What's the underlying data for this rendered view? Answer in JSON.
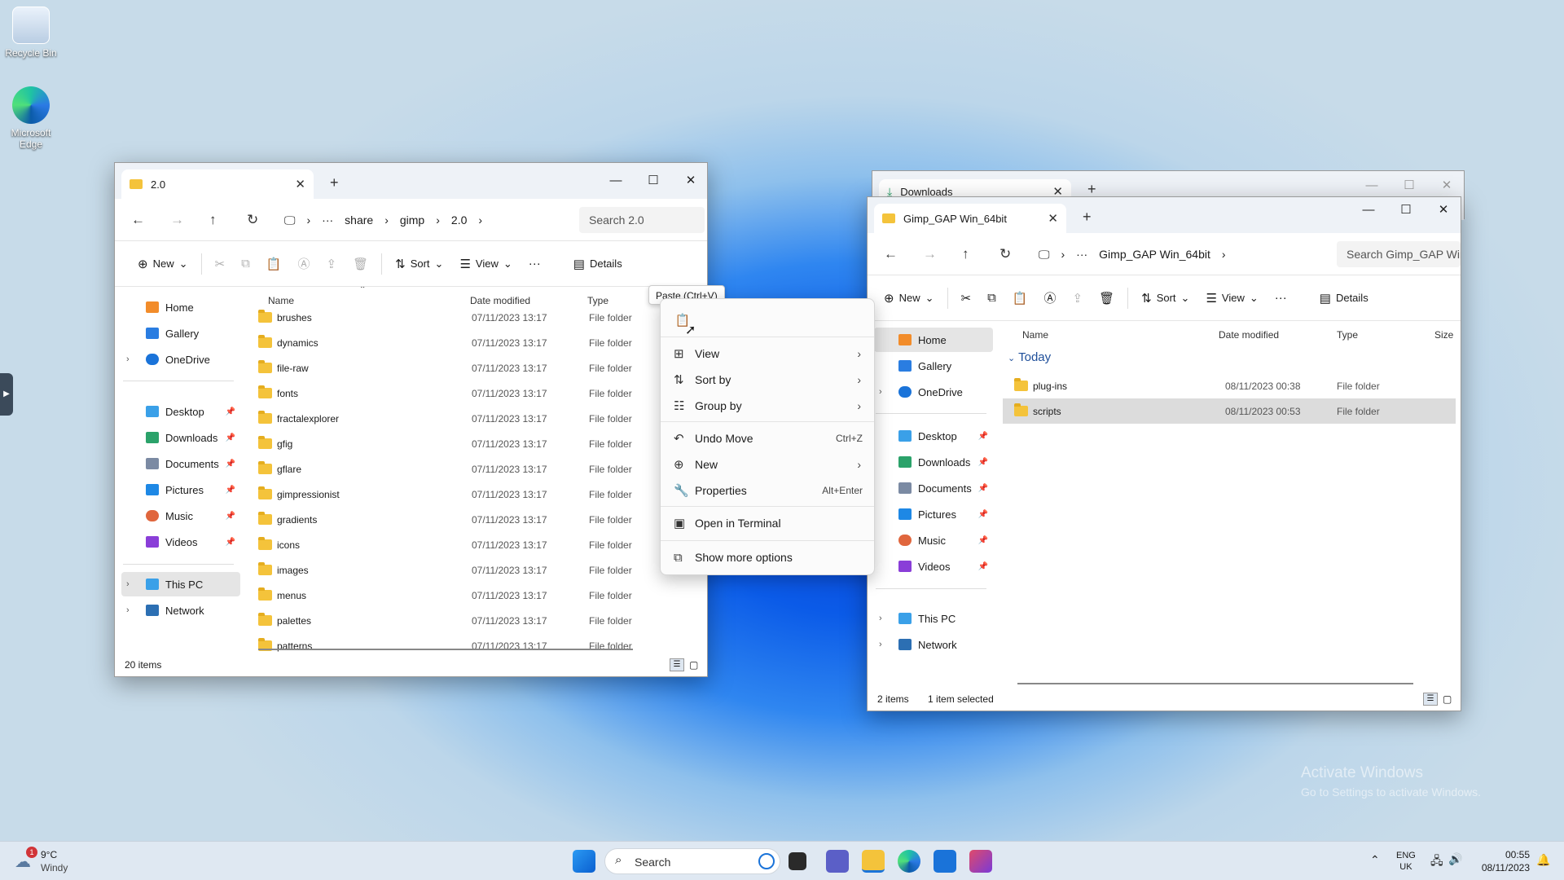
{
  "desktop": {
    "icons": [
      {
        "label": "Recycle Bin"
      },
      {
        "label": "Microsoft Edge"
      }
    ],
    "watermark": {
      "title": "Activate Windows",
      "subtitle": "Go to Settings to activate Windows."
    }
  },
  "win1": {
    "tab_title": "2.0",
    "breadcrumb": [
      "share",
      "gimp",
      "2.0"
    ],
    "search_placeholder": "Search 2.0",
    "commands": {
      "new": "New",
      "sort": "Sort",
      "view": "View",
      "details": "Details"
    },
    "nav": {
      "top": [
        "Home",
        "Gallery",
        "OneDrive"
      ],
      "pinned": [
        "Desktop",
        "Downloads",
        "Documents",
        "Pictures",
        "Music",
        "Videos"
      ],
      "bottom": [
        "This PC",
        "Network"
      ]
    },
    "columns": {
      "name": "Name",
      "date": "Date modified",
      "type": "Type"
    },
    "rows": [
      {
        "name": "brushes",
        "date": "07/11/2023 13:17",
        "type": "File folder"
      },
      {
        "name": "dynamics",
        "date": "07/11/2023 13:17",
        "type": "File folder"
      },
      {
        "name": "file-raw",
        "date": "07/11/2023 13:17",
        "type": "File folder"
      },
      {
        "name": "fonts",
        "date": "07/11/2023 13:17",
        "type": "File folder"
      },
      {
        "name": "fractalexplorer",
        "date": "07/11/2023 13:17",
        "type": "File folder"
      },
      {
        "name": "gfig",
        "date": "07/11/2023 13:17",
        "type": "File folder"
      },
      {
        "name": "gflare",
        "date": "07/11/2023 13:17",
        "type": "File folder"
      },
      {
        "name": "gimpressionist",
        "date": "07/11/2023 13:17",
        "type": "File folder"
      },
      {
        "name": "gradients",
        "date": "07/11/2023 13:17",
        "type": "File folder"
      },
      {
        "name": "icons",
        "date": "07/11/2023 13:17",
        "type": "File folder"
      },
      {
        "name": "images",
        "date": "07/11/2023 13:17",
        "type": "File folder"
      },
      {
        "name": "menus",
        "date": "07/11/2023 13:17",
        "type": "File folder"
      },
      {
        "name": "palettes",
        "date": "07/11/2023 13:17",
        "type": "File folder"
      },
      {
        "name": "patterns",
        "date": "07/11/2023 13:17",
        "type": "File folder"
      }
    ],
    "status": "20 items"
  },
  "downloads_tab": "Downloads",
  "win2": {
    "tab_title": "Gimp_GAP Win_64bit",
    "breadcrumb": [
      "Gimp_GAP Win_64bit"
    ],
    "search_placeholder": "Search Gimp_GAP Win",
    "commands": {
      "new": "New",
      "sort": "Sort",
      "view": "View",
      "details": "Details"
    },
    "nav": {
      "top": [
        "Home",
        "Gallery",
        "OneDrive"
      ],
      "pinned": [
        "Desktop",
        "Downloads",
        "Documents",
        "Pictures",
        "Music",
        "Videos"
      ],
      "bottom": [
        "This PC",
        "Network"
      ]
    },
    "columns": {
      "name": "Name",
      "date": "Date modified",
      "type": "Type",
      "size": "Size"
    },
    "group": "Today",
    "rows": [
      {
        "name": "plug-ins",
        "date": "08/11/2023 00:38",
        "type": "File folder"
      },
      {
        "name": "scripts",
        "date": "08/11/2023 00:53",
        "type": "File folder"
      }
    ],
    "status": {
      "count": "2 items",
      "selected": "1 item selected"
    }
  },
  "context_menu": {
    "tooltip": "Paste (Ctrl+V)",
    "items": [
      {
        "label": "View"
      },
      {
        "label": "Sort by"
      },
      {
        "label": "Group by"
      },
      {
        "label": "Undo Move",
        "shortcut": "Ctrl+Z"
      },
      {
        "label": "New"
      },
      {
        "label": "Properties",
        "shortcut": "Alt+Enter"
      },
      {
        "label": "Open in Terminal"
      },
      {
        "label": "Show more options"
      }
    ]
  },
  "taskbar": {
    "weather": {
      "temp": "9°C",
      "desc": "Windy",
      "badge": "1"
    },
    "search": "Search",
    "lang": {
      "line1": "ENG",
      "line2": "UK"
    },
    "time": "00:55",
    "date": "08/11/2023"
  }
}
